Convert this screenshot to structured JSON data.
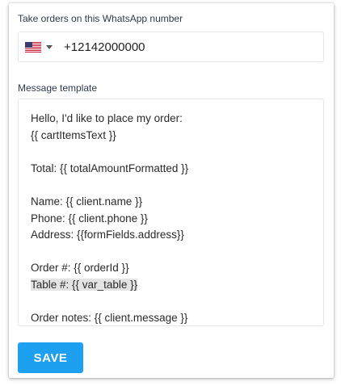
{
  "form": {
    "phone_label": "Take orders on this WhatsApp number",
    "phone_country": "us-flag-icon",
    "phone_value": "+12142000000",
    "template_label": "Message template",
    "template_lines": [
      "Hello, I'd like to place my order:",
      "{{ cartItemsText }}",
      "",
      "Total: {{ totalAmountFormatted }}",
      "",
      "Name: {{ client.name }}",
      "Phone: {{ client.phone }}",
      "Address: {{formFields.address}}",
      "",
      "Order #: {{ orderId }}",
      "Table #: {{ var_table }}",
      "",
      "Order notes: {{ client.message }}"
    ],
    "highlighted_line": "Table #: {{ var_table }}",
    "save_label": "SAVE"
  },
  "colors": {
    "accent": "#1ea0f0",
    "label_text": "#2f3a4c",
    "highlight": "#e4e4e4"
  }
}
